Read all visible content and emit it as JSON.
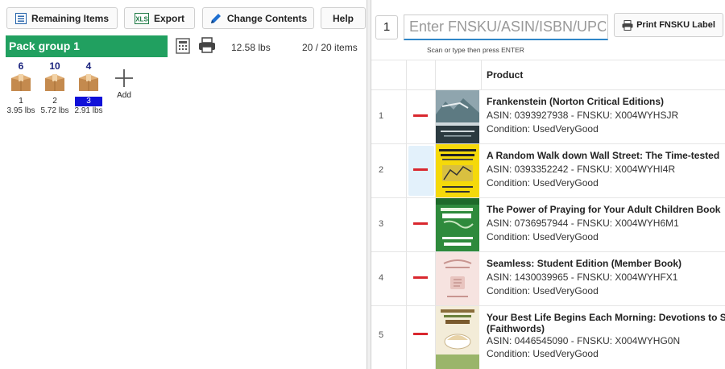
{
  "toolbar": {
    "remaining_items": "Remaining Items",
    "export": "Export",
    "change_contents": "Change Contents",
    "help": "Help"
  },
  "pack_group": {
    "title": "Pack group 1",
    "weight": "12.58 lbs",
    "items": "20 / 20 items"
  },
  "boxes": [
    {
      "count": "6",
      "number": "1",
      "weight": "3.95 lbs",
      "selected": false
    },
    {
      "count": "10",
      "number": "2",
      "weight": "5.72 lbs",
      "selected": false
    },
    {
      "count": "4",
      "number": "3",
      "weight": "2.91 lbs",
      "selected": true
    }
  ],
  "add_label": "Add",
  "scan": {
    "quantity": "1",
    "placeholder": "Enter FNSKU/ASIN/ISBN/UPC/E",
    "print_label": "Print FNSKU Label",
    "hint": "Scan or type then press ENTER"
  },
  "table": {
    "header": "Product",
    "rows": [
      {
        "index": "1",
        "title": "Frankenstein (Norton Critical Editions)",
        "title2": "",
        "asin": "ASIN: 0393927938 - FNSKU: X004WYHSJR",
        "condition": "Condition: UsedVeryGood",
        "cover": "frankenstein"
      },
      {
        "index": "2",
        "title": "A Random Walk down Wall Street: The Time-tested",
        "title2": "",
        "asin": "ASIN: 0393352242 - FNSKU: X004WYHI4R",
        "condition": "Condition: UsedVeryGood",
        "cover": "random-walk"
      },
      {
        "index": "3",
        "title": "The Power of Praying for Your Adult Children Book",
        "title2": "",
        "asin": "ASIN: 0736957944 - FNSKU: X004WYH6M1",
        "condition": "Condition: UsedVeryGood",
        "cover": "power-praying"
      },
      {
        "index": "4",
        "title": "Seamless: Student Edition (Member Book)",
        "title2": "",
        "asin": "ASIN: 1430039965 - FNSKU: X004WYHFX1",
        "condition": "Condition: UsedVeryGood",
        "cover": "seamless"
      },
      {
        "index": "5",
        "title": "Your Best Life Begins Each Morning: Devotions to S",
        "title2": "(Faithwords)",
        "asin": "ASIN: 0446545090 - FNSKU: X004WYHG0N",
        "condition": "Condition: UsedVeryGood",
        "cover": "best-life"
      }
    ]
  },
  "colors": {
    "pack_group_bg": "#21a060",
    "minus": "#d9272e",
    "selected_box": "#1010d8",
    "search_underline": "#2f86c8"
  }
}
